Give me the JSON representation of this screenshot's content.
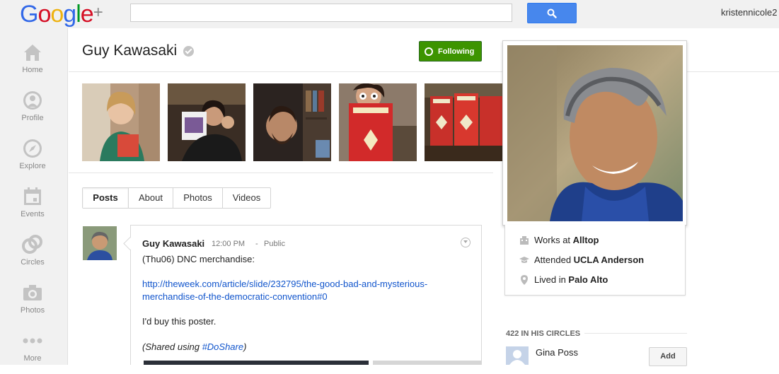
{
  "topbar": {
    "logo_text": "Google",
    "logo_plus": "+",
    "search_placeholder": "",
    "username": "kristennicole2"
  },
  "leftnav": {
    "items": [
      {
        "label": "Home",
        "icon": "home-icon"
      },
      {
        "label": "Profile",
        "icon": "profile-icon"
      },
      {
        "label": "Explore",
        "icon": "compass-icon"
      },
      {
        "label": "Events",
        "icon": "calendar-icon"
      },
      {
        "label": "Circles",
        "icon": "circles-icon"
      },
      {
        "label": "Photos",
        "icon": "camera-icon"
      },
      {
        "label": "More",
        "icon": "more-dots-icon"
      }
    ]
  },
  "header": {
    "name": "Guy Kawasaki",
    "follow_label": "Following"
  },
  "tabs": [
    {
      "label": "Posts"
    },
    {
      "label": "About"
    },
    {
      "label": "Photos"
    },
    {
      "label": "Videos"
    }
  ],
  "post": {
    "author": "Guy Kawasaki",
    "time": "12:00 PM",
    "separator": "-",
    "visibility": "Public",
    "text1": "(Thu06) DNC merchandise:",
    "link_line1": "http://theweek.com/article/slide/232795/the-good-bad-and-mysterious-",
    "link_line2": "merchandise-of-the-democratic-convention#0",
    "text2": "I'd buy this poster.",
    "shared_prefix": "(Shared using ",
    "shared_tag": "#DoShare",
    "shared_suffix": ")"
  },
  "about": {
    "works_label": "Works at ",
    "works_value": "Alltop",
    "attended_label": "Attended ",
    "attended_value": "UCLA Anderson",
    "lived_label": "Lived in ",
    "lived_value": "Palo Alto"
  },
  "circles": {
    "title": "422 IN HIS CIRCLES",
    "people": [
      {
        "name": "Gina Poss",
        "action": "Add"
      }
    ]
  },
  "colors": {
    "accent_blue": "#4787ed",
    "follow_green": "#3d9400",
    "link_blue": "#1155cc"
  }
}
